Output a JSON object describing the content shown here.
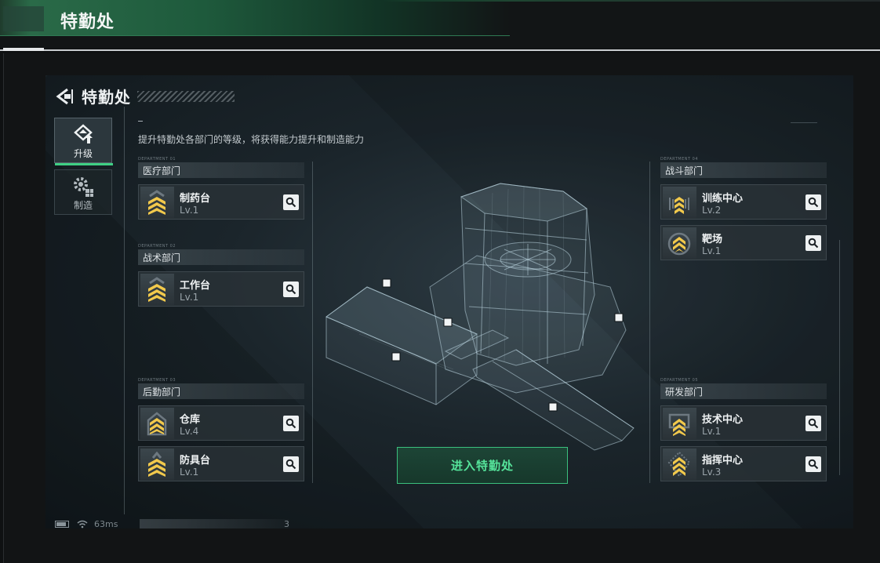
{
  "app_title": "特勤处",
  "screen": {
    "title": "特勤处",
    "description": "提升特勤处各部门的等级，将获得能力提升和制造能力"
  },
  "tabs": [
    {
      "label": "升级",
      "icon": "upgrade-icon",
      "active": true
    },
    {
      "label": "制造",
      "icon": "gears-icon",
      "active": false
    }
  ],
  "departments": {
    "medical": {
      "code": "DEPARTMENT 01",
      "title": "医疗部门",
      "items": [
        {
          "name": "制药台",
          "level": "Lv.1"
        }
      ]
    },
    "tactical": {
      "code": "DEPARTMENT 02",
      "title": "战术部门",
      "items": [
        {
          "name": "工作台",
          "level": "Lv.1"
        }
      ]
    },
    "logistics": {
      "code": "DEPARTMENT 03",
      "title": "后勤部门",
      "items": [
        {
          "name": "仓库",
          "level": "Lv.4"
        },
        {
          "name": "防具台",
          "level": "Lv.1"
        }
      ]
    },
    "combat": {
      "code": "DEPARTMENT 04",
      "title": "战斗部门",
      "items": [
        {
          "name": "训练中心",
          "level": "Lv.2"
        },
        {
          "name": "靶场",
          "level": "Lv.1"
        }
      ]
    },
    "research": {
      "code": "DEPARTMENT 05",
      "title": "研发部门",
      "items": [
        {
          "name": "技术中心",
          "level": "Lv.1"
        },
        {
          "name": "指挥中心",
          "level": "Lv.3"
        }
      ]
    }
  },
  "enter_button": "进入特勤处",
  "status": {
    "ping": "63ms",
    "counter": "3"
  },
  "colors": {
    "accent_green": "#3fcf84",
    "rank_yellow": "#f2c94c"
  }
}
